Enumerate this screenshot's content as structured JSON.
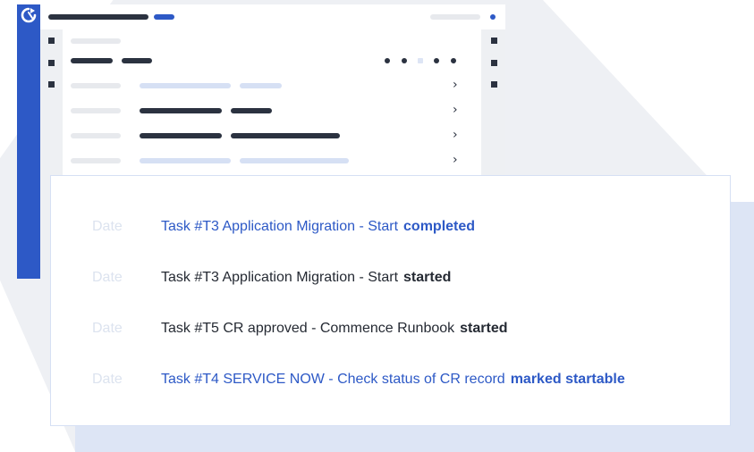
{
  "colors": {
    "accent": "#2d59c6",
    "dark_text": "#252a33",
    "muted": "#dce3ef",
    "background_panel": "#dde5f5"
  },
  "app": {
    "logo_icon": "refresh-logo-icon"
  },
  "activity": [
    {
      "date": "Date",
      "text": "Task #T3 Application Migration - Start",
      "status": "completed",
      "tone": "blue"
    },
    {
      "date": "Date",
      "text": "Task #T3 Application Migration - Start",
      "status": "started",
      "tone": "dark"
    },
    {
      "date": "Date",
      "text": "Task #T5 CR approved - Commence Runbook",
      "status": "started",
      "tone": "dark"
    },
    {
      "date": "Date",
      "text": "Task #T4 SERVICE NOW - Check status of CR record",
      "status": "marked startable",
      "tone": "blue"
    }
  ]
}
